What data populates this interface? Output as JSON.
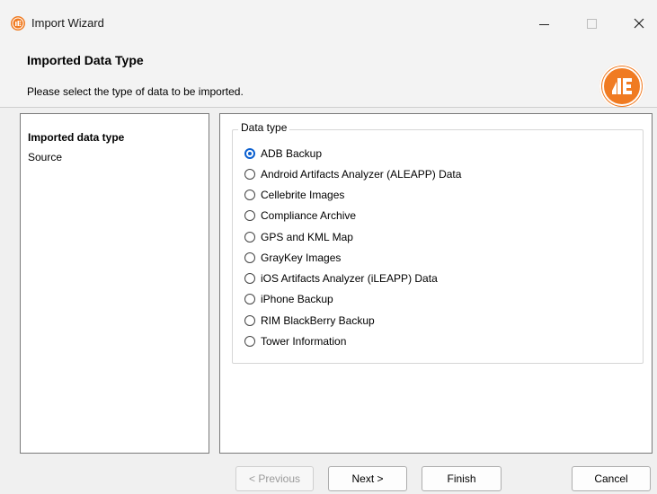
{
  "window": {
    "title": "Import Wizard"
  },
  "header": {
    "title": "Imported Data Type",
    "description": "Please select the type of data to be imported."
  },
  "steps": [
    {
      "label": "Imported data type",
      "active": true
    },
    {
      "label": "Source",
      "active": false
    }
  ],
  "data_type": {
    "group_label": "Data type",
    "selected_index": 0,
    "options": [
      "ADB Backup",
      "Android Artifacts Analyzer (ALEAPP) Data",
      "Cellebrite Images",
      "Compliance Archive",
      "GPS and KML Map",
      "GrayKey Images",
      "iOS Artifacts Analyzer (iLEAPP) Data",
      "iPhone Backup",
      "RIM BlackBerry Backup",
      "Tower Information"
    ]
  },
  "buttons": {
    "previous": "< Previous",
    "next": "Next >",
    "finish": "Finish",
    "cancel": "Cancel"
  },
  "colors": {
    "brand_orange": "#f07b22",
    "radio_selected": "#0a5fd0"
  }
}
